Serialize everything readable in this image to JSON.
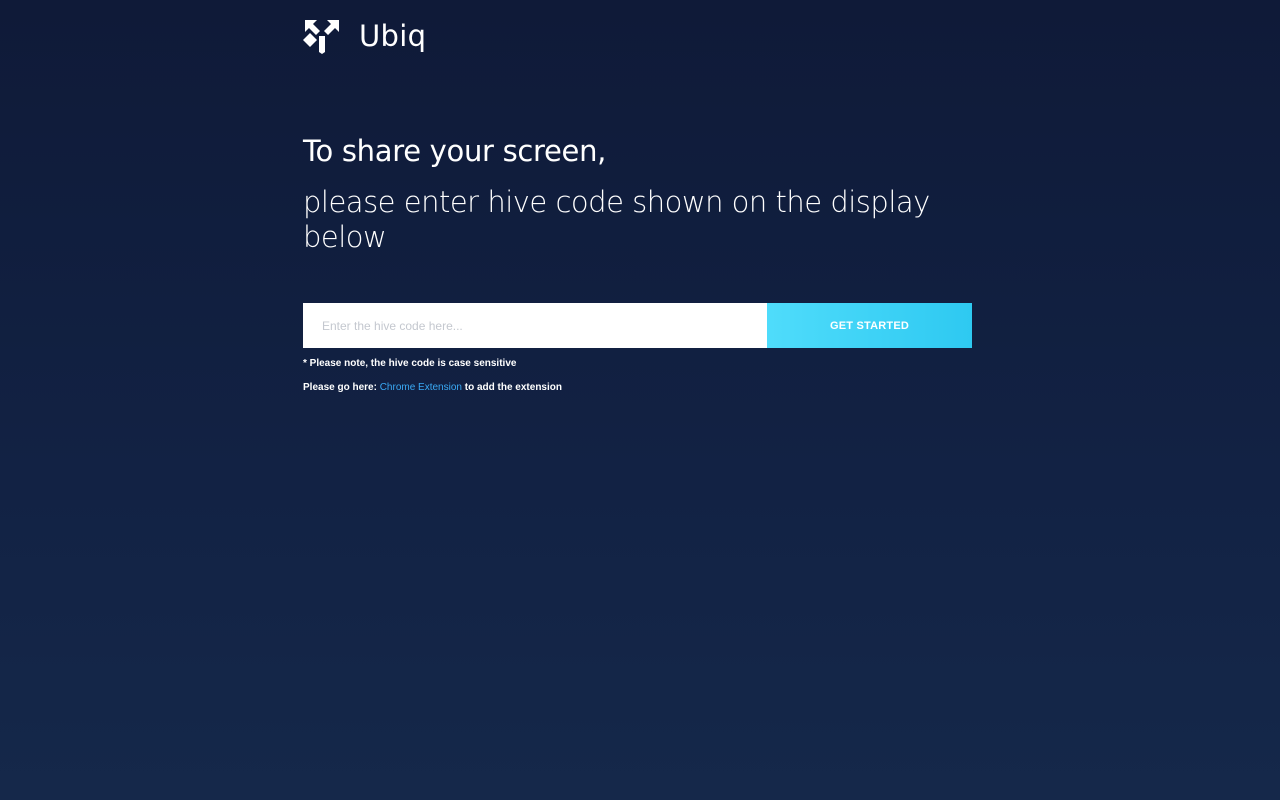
{
  "brand": {
    "name": "Ubiq",
    "logo_icon": "diverging-arrows-icon"
  },
  "hero": {
    "title": "To share your screen,",
    "subtitle": "please enter hive code shown on the display below"
  },
  "form": {
    "input_placeholder": "Enter the hive code here...",
    "input_value": "",
    "submit_label": "GET STARTED"
  },
  "notes": {
    "case_note": "* Please note, the hive code is case sensitive",
    "extension_prefix": "Please go here:",
    "extension_link_label": "Chrome Extension",
    "extension_suffix": "to add the extension"
  },
  "colors": {
    "background_top": "#0f1a38",
    "background_bottom": "#15284a",
    "button_accent": "#2ec9f1",
    "link": "#3aa9f5"
  }
}
